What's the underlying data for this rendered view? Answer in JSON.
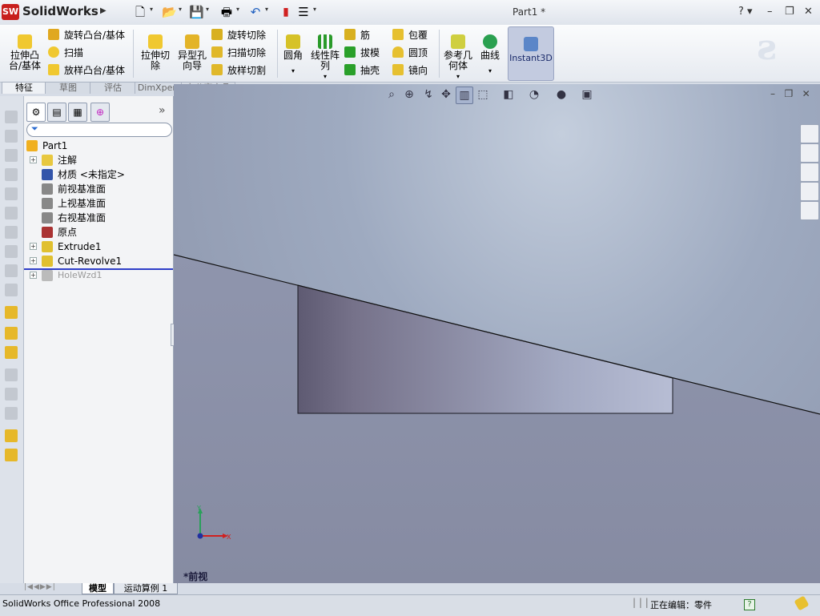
{
  "app": {
    "logo_text": "SolidWorks",
    "logo_badge": "SW",
    "document_title": "Part1 *",
    "help_label": "?"
  },
  "quick_access": [
    {
      "name": "new-document-icon",
      "glyph": "🗋"
    },
    {
      "name": "open-folder-icon",
      "glyph": "📂"
    },
    {
      "name": "save-icon",
      "glyph": "💾"
    },
    {
      "name": "print-icon",
      "glyph": "🖶"
    },
    {
      "name": "undo-icon",
      "glyph": "↶"
    },
    {
      "name": "rebuild-icon",
      "glyph": "▮"
    },
    {
      "name": "options-icon",
      "glyph": "☰"
    }
  ],
  "commands": {
    "extrude_boss": "拉伸凸\n台/基体",
    "revolve_boss": "旋转凸台/基体",
    "sweep": "扫描",
    "loft_boss": "放样凸台/基体",
    "extrude_cut": "拉伸切\n除",
    "hole_wizard": "异型孔\n向导",
    "revolve_cut": "旋转切除",
    "sweep_cut": "扫描切除",
    "loft_cut": "放样切割",
    "fillet": "圆角",
    "linear_pattern": "线性阵\n列",
    "rib": "筋",
    "draft": "拔模",
    "shell": "抽壳",
    "wrap": "包覆",
    "dome": "圆顶",
    "mirror": "镜向",
    "ref_geometry": "参考几\n何体",
    "curves": "曲线",
    "instant3d": "Instant3D"
  },
  "cmd_tabs": [
    "特征",
    "草图",
    "评估",
    "DimXpert",
    "办公室产品"
  ],
  "feature_tree": {
    "filter_placeholder": "",
    "items": [
      {
        "label": "Part1",
        "expandable": false,
        "indent": 0,
        "color": "#f0b020"
      },
      {
        "label": "注解",
        "expandable": true,
        "indent": 1,
        "color": "#e8c840"
      },
      {
        "label": "材质 <未指定>",
        "expandable": false,
        "indent": 1,
        "color": "#3355aa"
      },
      {
        "label": "前视基准面",
        "expandable": false,
        "indent": 1,
        "color": "#888888"
      },
      {
        "label": "上视基准面",
        "expandable": false,
        "indent": 1,
        "color": "#888888"
      },
      {
        "label": "右视基准面",
        "expandable": false,
        "indent": 1,
        "color": "#888888"
      },
      {
        "label": "原点",
        "expandable": false,
        "indent": 1,
        "color": "#aa3333"
      },
      {
        "label": "Extrude1",
        "expandable": true,
        "indent": 1,
        "color": "#e0c030"
      },
      {
        "label": "Cut-Revolve1",
        "expandable": true,
        "indent": 1,
        "color": "#e0c030"
      },
      {
        "label": "HoleWzd1",
        "expandable": true,
        "indent": 1,
        "color": "#bbbbbb",
        "suppressed": true
      }
    ],
    "bottom_tabs": [
      "模型",
      "运动算例 1"
    ]
  },
  "viewport": {
    "view_label": "*前视",
    "triad_x": "X",
    "triad_y": "Y"
  },
  "status": {
    "product": "SolidWorks Office Professional 2008",
    "editing": "正在编辑：零件",
    "help_badge": "?"
  }
}
